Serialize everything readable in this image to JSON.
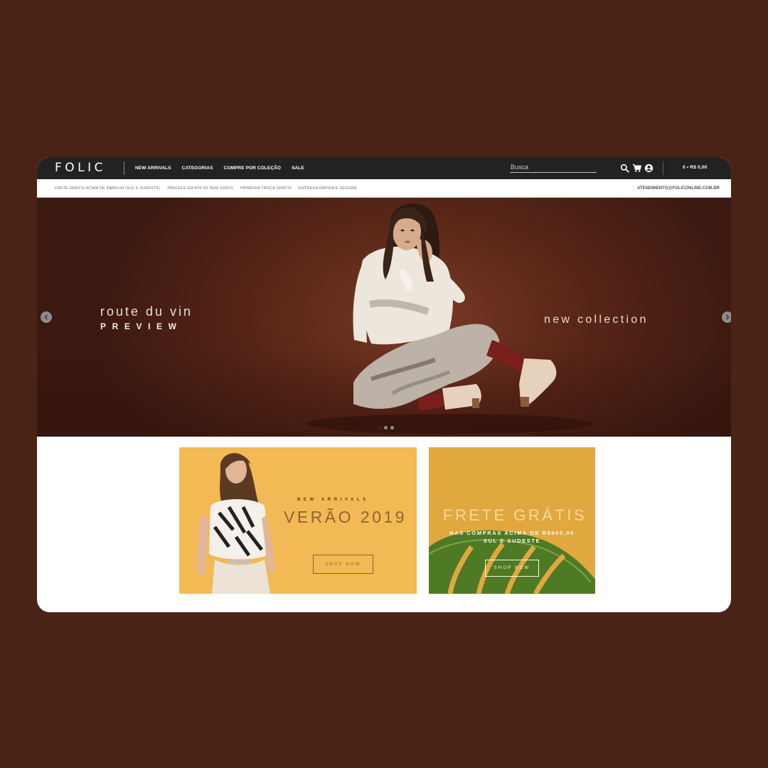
{
  "header": {
    "logo": "FOLIC",
    "nav": [
      "NEW ARRIVALS",
      "CATEGORIAS",
      "COMPRE POR COLEÇÃO",
      "SALE"
    ],
    "search_placeholder": "Busca",
    "icons": [
      "search-icon",
      "cart-icon",
      "user-icon"
    ],
    "cart_total": "0 • R$ 0,00"
  },
  "infobar": {
    "items": [
      "FRETE GRÁTIS ACIMA DE R$800,00 (Sul e Sudeste)",
      "PARCELE EM ATÉ 6X SEM JUROS",
      "PRIMEIRA TROCA GRÁTIS",
      "ENTREGA RÁPIDA E SEGURA"
    ],
    "contact": "ATENDIMENTO@FOLICONLINE.COM.BR"
  },
  "hero": {
    "title": "route du vin",
    "subtitle": "PREVIEW",
    "tagline": "new collection",
    "slide_count": 3,
    "active_slide": 1
  },
  "promos": {
    "p1": {
      "kicker": "NEW ARRIVALS",
      "title": "VERÃO 2019",
      "button": "SHOP NOW"
    },
    "p2": {
      "title": "FRETE GRÁTIS",
      "line1": "NAS COMPRAS ACIMA DE R$800,00",
      "line2": "SUL E SUDESTE",
      "button": "SHOP NOW"
    }
  },
  "colors": {
    "page_background": "#4a2316",
    "header": "#232222",
    "promo_yellow": "#f3b955",
    "promo_mustard": "#e0a83e"
  }
}
